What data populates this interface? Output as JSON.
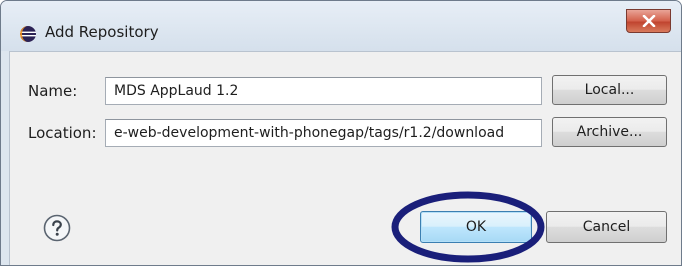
{
  "dialog": {
    "title": "Add Repository",
    "close_icon": "close-icon",
    "app_icon": "eclipse-icon"
  },
  "form": {
    "name_label": "Name:",
    "name_value": "MDS AppLaud 1.2",
    "location_label": "Location:",
    "location_value": "e-web-development-with-phonegap/tags/r1.2/download",
    "local_button": "Local...",
    "archive_button": "Archive..."
  },
  "footer": {
    "help_icon": "help-icon",
    "ok_button": "OK",
    "cancel_button": "Cancel"
  },
  "colors": {
    "highlight_ellipse": "#1a1f7a",
    "window_chrome": "#dde6ef",
    "client_bg": "#f0f0f0"
  }
}
